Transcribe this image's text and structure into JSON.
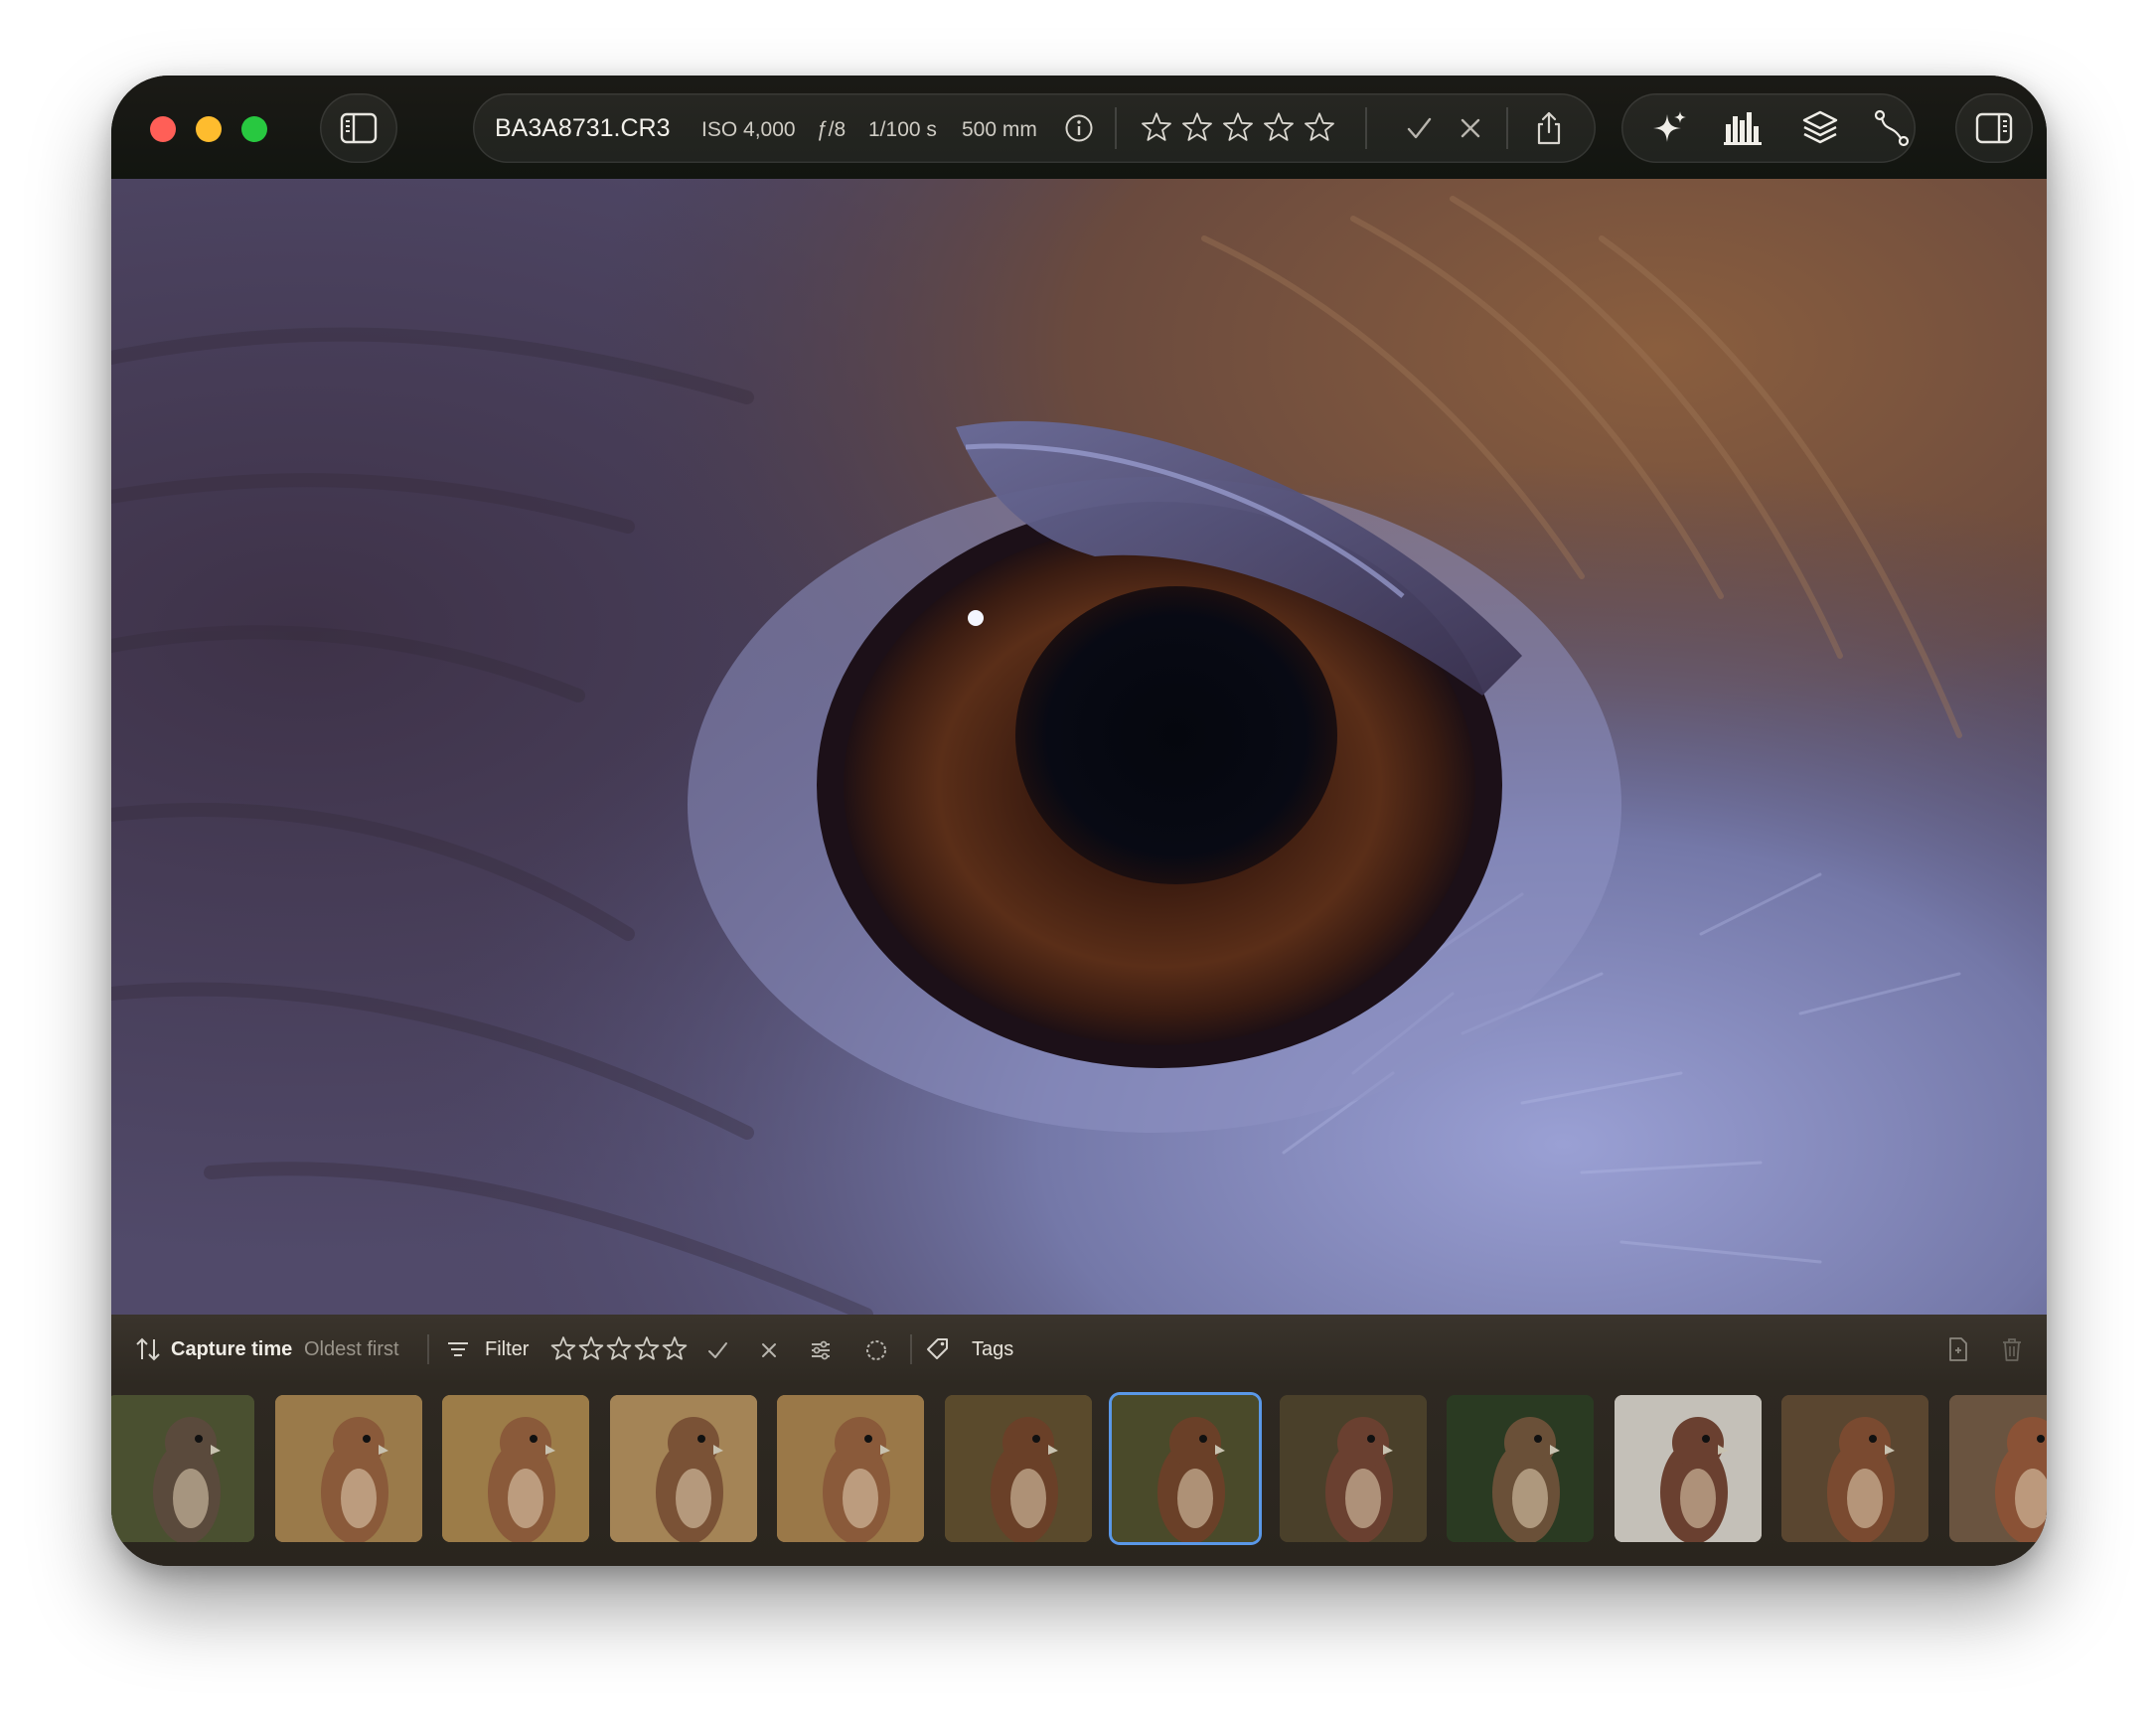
{
  "window": {
    "filename": "BA3A8731.CR3",
    "iso": "ISO 4,000",
    "aperture": "ƒ/8",
    "shutter": "1/100 s",
    "focal_length": "500 mm"
  },
  "toolbar": {
    "rating_stars": 5,
    "icons": [
      "sidebar-left-icon",
      "info-icon",
      "star-icon",
      "checkmark-icon",
      "reject-x-icon",
      "share-icon",
      "sparkle-icon",
      "histogram-icon",
      "layers-icon",
      "curve-tool-icon",
      "sidebar-right-icon"
    ]
  },
  "photo": {
    "subject": "eye"
  },
  "filterbar": {
    "sort_label": "Capture time",
    "sort_order": "Oldest first",
    "filter_label": "Filter",
    "tags_label": "Tags",
    "filter_stars": 5
  },
  "filmstrip": {
    "selected_index": 6,
    "thumbnails": [
      {
        "name": "thumb-owl",
        "bg": "#4a5030",
        "bird": "#5a4a3c"
      },
      {
        "name": "thumb-kestrel",
        "bg": "#9a7a4a",
        "bird": "#8a5a3a"
      },
      {
        "name": "thumb-kestrel",
        "bg": "#9c7c48",
        "bird": "#8a5a3a"
      },
      {
        "name": "thumb-kestrel",
        "bg": "#a48456",
        "bird": "#7a5236"
      },
      {
        "name": "thumb-kestrel",
        "bg": "#9a7848",
        "bird": "#8a5a3a"
      },
      {
        "name": "thumb-hawk",
        "bg": "#5a4a2c",
        "bird": "#6a4028"
      },
      {
        "name": "thumb-hawk",
        "bg": "#4a4a2a",
        "bird": "#6a4028"
      },
      {
        "name": "thumb-hawk",
        "bg": "#4a402a",
        "bird": "#6a4030"
      },
      {
        "name": "thumb-hawk-perched",
        "bg": "#2a3a22",
        "bird": "#6a5038"
      },
      {
        "name": "thumb-hawk",
        "bg": "#c4c0b8",
        "bird": "#6a4030"
      },
      {
        "name": "thumb-hawk",
        "bg": "#5a4630",
        "bird": "#7a4a30"
      },
      {
        "name": "thumb-hawk",
        "bg": "#6a5440",
        "bird": "#8a5236"
      }
    ]
  }
}
